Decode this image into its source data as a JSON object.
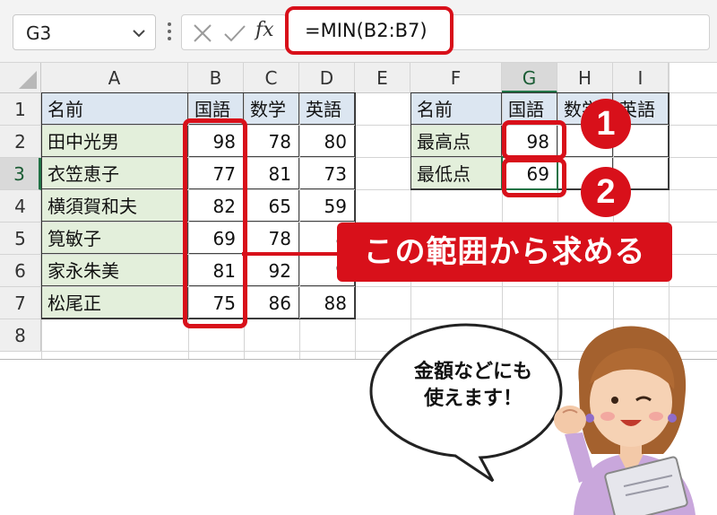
{
  "formula_bar": {
    "name_box": "G3",
    "fx_label": "fx",
    "formula": "=MIN(B2:B7)"
  },
  "grid": {
    "columns": [
      "A",
      "B",
      "C",
      "D",
      "E",
      "F",
      "G",
      "H",
      "I"
    ],
    "rows": [
      "1",
      "2",
      "3",
      "4",
      "5",
      "6",
      "7",
      "8"
    ],
    "selected_cell": "G3",
    "table": {
      "headers": [
        "名前",
        "国語",
        "数学",
        "英語"
      ],
      "rows": [
        [
          "田中光男",
          "98",
          "78",
          "80"
        ],
        [
          "衣笠恵子",
          "77",
          "81",
          "73"
        ],
        [
          "横須賀和夫",
          "82",
          "65",
          "59"
        ],
        [
          "筧敏子",
          "69",
          "78",
          "8"
        ],
        [
          "家永朱美",
          "81",
          "92",
          "9"
        ],
        [
          "松尾正",
          "75",
          "86",
          "88"
        ]
      ]
    },
    "summary": {
      "headers": [
        "名前",
        "国語",
        "数学",
        "英語"
      ],
      "rows": [
        [
          "最高点",
          "98"
        ],
        [
          "最低点",
          "69"
        ]
      ]
    }
  },
  "annotations": {
    "badge_1": "1",
    "badge_2": "2",
    "range_label": "この範囲から求める",
    "speech_bubble": [
      "金額などにも",
      "使えます！"
    ]
  },
  "colors": {
    "accent_red": "#d8101a",
    "name_fill": "#e3efdb",
    "header_fill": "#dce6f1",
    "excel_green": "#217346"
  }
}
